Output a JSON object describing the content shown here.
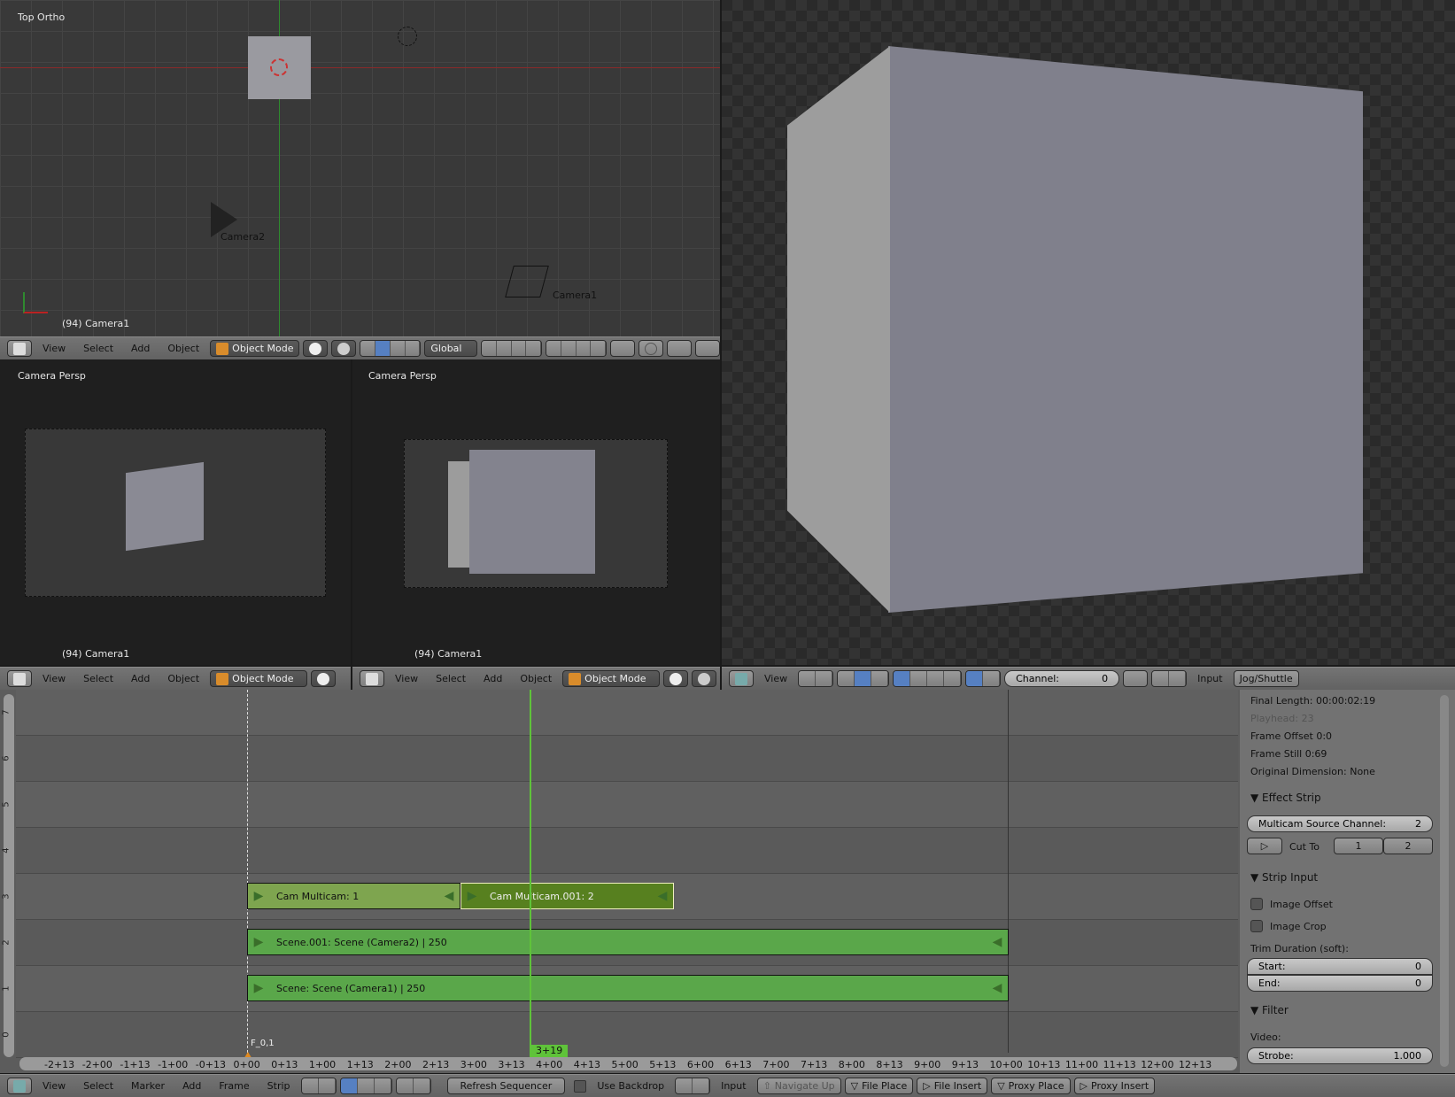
{
  "viewports": {
    "top": {
      "label": "Top Ortho",
      "object_info": "(94) Camera1",
      "objects": [
        "Camera2",
        "Camera1"
      ]
    },
    "cam_left": {
      "label": "Camera Persp",
      "object_info": "(94) Camera1"
    },
    "cam_right": {
      "label": "Camera Persp",
      "object_info": "(94) Camera1"
    }
  },
  "view3d_header": {
    "menus": [
      "View",
      "Select",
      "Add",
      "Object"
    ],
    "mode": "Object Mode",
    "orientation": "Global"
  },
  "preview_header": {
    "menus": [
      "View"
    ],
    "channel_label": "Channel:",
    "channel_value": "0",
    "input_label": "Input",
    "jog_label": "Jog/Shuttle"
  },
  "sequencer": {
    "channels": [
      "7",
      "6",
      "5",
      "4",
      "3",
      "2",
      "1",
      "0"
    ],
    "strips": [
      {
        "name": "Cam Multicam: 1",
        "channel": 3,
        "start": 0,
        "end": 67,
        "color": "#7ea54f"
      },
      {
        "name": "Cam Multicam.001: 2",
        "channel": 3,
        "start": 67,
        "end": 136,
        "color": "#57801f",
        "selected": true
      },
      {
        "name": "Scene.001: Scene (Camera2) | 250",
        "channel": 2,
        "start": 0,
        "end": 250,
        "color": "#5aa74a"
      },
      {
        "name": "Scene: Scene (Camera1) | 250",
        "channel": 1,
        "start": 0,
        "end": 250,
        "color": "#5aa74a"
      }
    ],
    "playhead_label": "3+19",
    "marker_label": "F_0,1",
    "time_ticks": [
      "-2+13",
      "-2+00",
      "-1+13",
      "-1+00",
      "-0+13",
      "0+00",
      "0+13",
      "1+00",
      "1+13",
      "2+00",
      "2+13",
      "3+00",
      "3+13",
      "4+00",
      "4+13",
      "5+00",
      "5+13",
      "6+00",
      "6+13",
      "7+00",
      "7+13",
      "8+00",
      "8+13",
      "9+00",
      "9+13",
      "10+00",
      "10+13",
      "11+00",
      "11+13",
      "12+00",
      "12+13"
    ]
  },
  "properties": {
    "info": {
      "final_length": "Final Length: 00:00:02:19",
      "playhead": "Playhead: 23",
      "frame_offset": "Frame Offset 0:0",
      "frame_still": "Frame Still 0:69",
      "original_dimension": "Original Dimension: None"
    },
    "effect_strip": {
      "title": "Effect Strip",
      "source_channel_label": "Multicam Source Channel:",
      "source_channel_value": "2",
      "cut_to_label": "Cut To",
      "cut_buttons": [
        "1",
        "2"
      ]
    },
    "strip_input": {
      "title": "Strip Input",
      "image_offset": "Image Offset",
      "image_crop": "Image Crop",
      "trim_label": "Trim Duration (soft):",
      "start_label": "Start:",
      "start_value": "0",
      "end_label": "End:",
      "end_value": "0"
    },
    "filter": {
      "title": "Filter",
      "video_label": "Video:",
      "strobe_label": "Strobe:",
      "strobe_value": "1.000"
    }
  },
  "seq_header": {
    "menus": [
      "View",
      "Select",
      "Marker",
      "Add",
      "Frame",
      "Strip"
    ],
    "refresh": "Refresh Sequencer",
    "use_backdrop": "Use Backdrop",
    "input": "Input",
    "navigate_up": "Navigate Up",
    "file_place": "File Place",
    "file_insert": "File Insert",
    "proxy_place": "Proxy Place",
    "proxy_insert": "Proxy Insert"
  },
  "colors": {
    "playhead": "#5fc33a",
    "selected_outline": "#f0f0c0",
    "view_bg": "#393939"
  }
}
